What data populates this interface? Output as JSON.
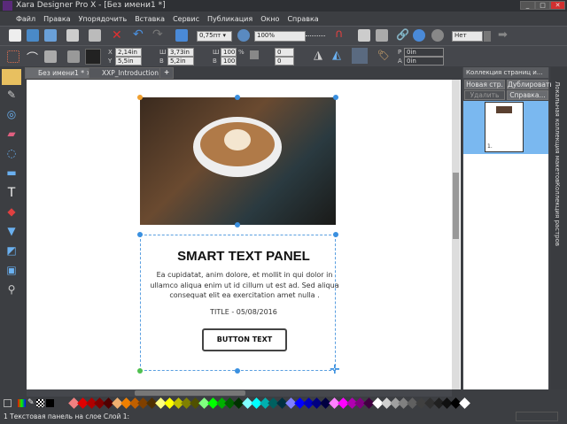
{
  "window": {
    "title": "Xara Designer Pro X - [Без имени1 *]"
  },
  "menu": [
    "Файл",
    "Правка",
    "Упорядочить",
    "Вставка",
    "Сервис",
    "Публикация",
    "Окно",
    "Справка"
  ],
  "toolbar": {
    "line_width": "0,75пт",
    "zoom": "100%",
    "quality": "Нет"
  },
  "infobar": {
    "x_label": "X",
    "x": "2,14in",
    "y_label": "Y",
    "y": "5,5in",
    "w_label": "Ш",
    "w": "3,73in",
    "h_label": "В",
    "h": "5,2in",
    "sw_label": "Ш",
    "sw": "100",
    "sh_label": "В",
    "sh": "100",
    "pct": "%",
    "rot": "0",
    "skew": "0",
    "p_label": "P",
    "p": "0in",
    "a_label": "A",
    "a": "0in"
  },
  "tabs": [
    {
      "label": "Без имени1 *"
    },
    {
      "label": "XXP_Introduction"
    }
  ],
  "card": {
    "title": "SMART TEXT PANEL",
    "body": "Ea cupidatat, anim dolore, et mollit in qui dolor in ullamco aliqua enim ut id cillum ut est ad. Sed aliqua consequat elit ea exercitation amet nulla .",
    "date": "TITLE - 05/08/2016",
    "button": "BUTTON TEXT"
  },
  "panel": {
    "title": "Коллекция страниц и...",
    "new_page": "Новая стр.",
    "duplicate": "Дублировать",
    "delete": "Удалить",
    "help": "Справка...",
    "page_number": "1."
  },
  "side_tabs": [
    "Локальная коллекция макетов",
    "Коллекция растров"
  ],
  "palette": [
    "#f08080",
    "#e00000",
    "#b00000",
    "#800000",
    "#500000",
    "#f0b070",
    "#f08000",
    "#c06000",
    "#804000",
    "#503000",
    "#ffff80",
    "#ffff00",
    "#c0c000",
    "#808000",
    "#505000",
    "#80ff80",
    "#00ff00",
    "#00b000",
    "#006000",
    "#003000",
    "#80ffff",
    "#00ffff",
    "#00b0b0",
    "#006060",
    "#003040",
    "#8080ff",
    "#0000ff",
    "#0000c0",
    "#000080",
    "#000040",
    "#ff80ff",
    "#ff00ff",
    "#b000b0",
    "#800080",
    "#400040",
    "#ffffff",
    "#d0d0d0",
    "#a0a0a0",
    "#808080",
    "#606060",
    "#404040",
    "#303030",
    "#202020",
    "#101010",
    "#000000",
    "#ffffff"
  ],
  "status": {
    "text": "1 Текстовая панель на слое Слой 1:"
  }
}
